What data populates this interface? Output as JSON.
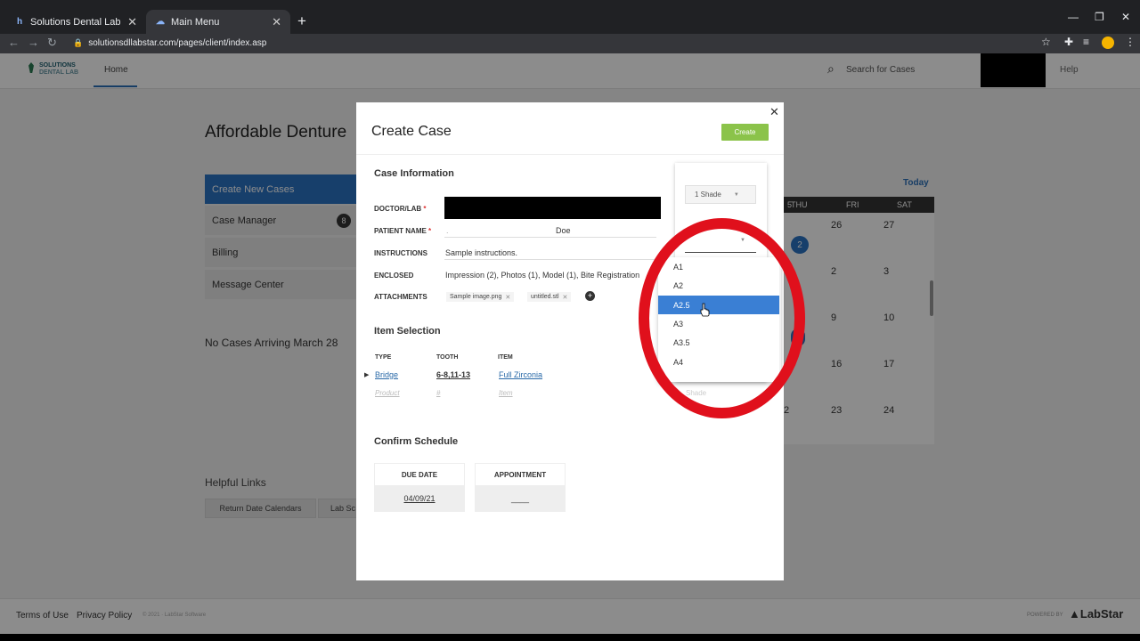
{
  "browser": {
    "tabs": [
      {
        "title": "Solutions Dental Lab",
        "favicon": "labstar-favicon"
      },
      {
        "title": "Main Menu",
        "favicon": "cloud-favicon"
      }
    ],
    "url": "solutionsdllabstar.com/pages/client/index.asp"
  },
  "app": {
    "logo": {
      "line1": "SOLUTIONS",
      "line2": "DENTAL LAB"
    },
    "nav_home": "Home",
    "search_placeholder": "Search for Cases",
    "help": "Help",
    "page_title": "Affordable Denture",
    "sidebar": [
      {
        "label": "Create New Cases",
        "active": true
      },
      {
        "label": "Case Manager",
        "badge": "8"
      },
      {
        "label": "Billing"
      },
      {
        "label": "Message Center"
      }
    ],
    "no_cases": "No Cases Arriving March 28",
    "helpful_links": "Helpful Links",
    "link_buttons": [
      "Return Date Calendars",
      "Lab Sc"
    ],
    "calendar": {
      "today": "Today",
      "days": [
        "THU",
        "FRI",
        "SAT"
      ],
      "rows": [
        [
          "2",
          "26",
          "27"
        ],
        [
          "",
          "2",
          "3"
        ],
        [
          "",
          "9",
          "10"
        ],
        [
          "",
          "16",
          "17"
        ],
        [
          "2",
          "23",
          "24"
        ]
      ],
      "first_col_fragments": [
        "5",
        "3"
      ],
      "highlight_dots": [
        "2",
        "3"
      ]
    },
    "footer": {
      "terms": "Terms of Use",
      "privacy": "Privacy Policy",
      "copyright": "© 2021 · LabStar Software",
      "powered_by": "POWERED BY",
      "labstar": "LabStar"
    }
  },
  "modal": {
    "title": "Create Case",
    "create_button": "Create",
    "case_info_heading": "Case Information",
    "fields": {
      "doctor_label": "DOCTOR/LAB",
      "patient_label": "PATIENT NAME",
      "patient_first": ".",
      "patient_last": "Doe",
      "instructions_label": "INSTRUCTIONS",
      "instructions_value": "Sample instructions.",
      "enclosed_label": "ENCLOSED",
      "enclosed_value": "Impression (2), Photos (1), Model (1), Bite Registration",
      "attachments_label": "ATTACHMENTS",
      "attachments": [
        "Sample image.png",
        "untitled.stl"
      ]
    },
    "item_selection_heading": "Item Selection",
    "item_columns": [
      "TYPE",
      "TOOTH",
      "ITEM"
    ],
    "item_row": {
      "type": "Bridge",
      "tooth": "6-8,11-13",
      "item": "Full Zirconia"
    },
    "item_placeholders": {
      "product": "Product",
      "tooth": "#",
      "item": "Item"
    },
    "schedule_heading": "Confirm Schedule",
    "due_date_label": "DUE DATE",
    "due_date_value": "04/09/21",
    "appointment_label": "APPOINTMENT",
    "appointment_value": "____"
  },
  "shade": {
    "mode": "1 Shade",
    "shade_placeholder": "Shade",
    "options": [
      "A1",
      "A2",
      "A2.5",
      "A3",
      "A3.5",
      "A4"
    ],
    "selected": "A2.5"
  },
  "colors": {
    "accent": "#2b73c4",
    "create_green": "#8bc34a",
    "annotation_ring": "#e0101c"
  }
}
